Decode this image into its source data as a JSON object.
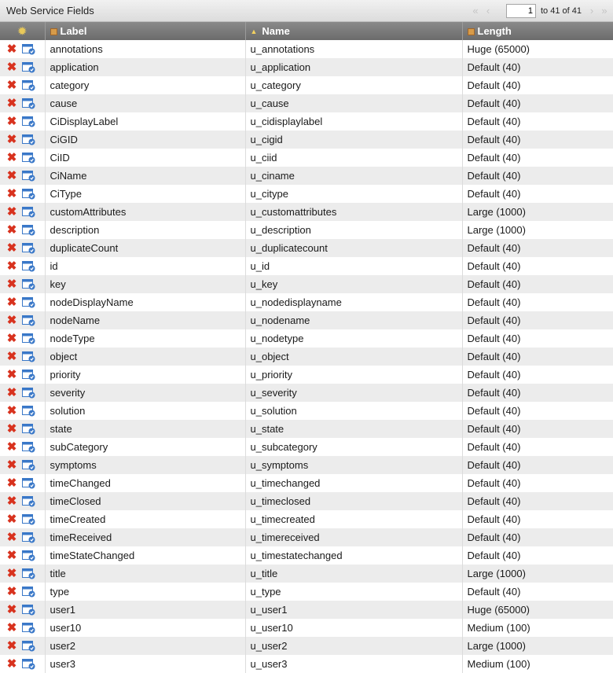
{
  "panel": {
    "title": "Web Service Fields"
  },
  "pager": {
    "current": "1",
    "total_text": "to 41 of 41"
  },
  "columns": {
    "label": "Label",
    "name": "Name",
    "length": "Length"
  },
  "rows": [
    {
      "label": "annotations",
      "name": "u_annotations",
      "length": "Huge (65000)"
    },
    {
      "label": "application",
      "name": "u_application",
      "length": "Default (40)"
    },
    {
      "label": "category",
      "name": "u_category",
      "length": "Default (40)"
    },
    {
      "label": "cause",
      "name": "u_cause",
      "length": "Default (40)"
    },
    {
      "label": "CiDisplayLabel",
      "name": "u_cidisplaylabel",
      "length": "Default (40)"
    },
    {
      "label": "CiGID",
      "name": "u_cigid",
      "length": "Default (40)"
    },
    {
      "label": "CiID",
      "name": "u_ciid",
      "length": "Default (40)"
    },
    {
      "label": "CiName",
      "name": "u_ciname",
      "length": "Default (40)"
    },
    {
      "label": "CiType",
      "name": "u_citype",
      "length": "Default (40)"
    },
    {
      "label": "customAttributes",
      "name": "u_customattributes",
      "length": "Large (1000)"
    },
    {
      "label": "description",
      "name": "u_description",
      "length": "Large (1000)"
    },
    {
      "label": "duplicateCount",
      "name": "u_duplicatecount",
      "length": "Default (40)"
    },
    {
      "label": "id",
      "name": "u_id",
      "length": "Default (40)"
    },
    {
      "label": "key",
      "name": "u_key",
      "length": "Default (40)"
    },
    {
      "label": "nodeDisplayName",
      "name": "u_nodedisplayname",
      "length": "Default (40)"
    },
    {
      "label": "nodeName",
      "name": "u_nodename",
      "length": "Default (40)"
    },
    {
      "label": "nodeType",
      "name": "u_nodetype",
      "length": "Default (40)"
    },
    {
      "label": "object",
      "name": "u_object",
      "length": "Default (40)"
    },
    {
      "label": "priority",
      "name": "u_priority",
      "length": "Default (40)"
    },
    {
      "label": "severity",
      "name": "u_severity",
      "length": "Default (40)"
    },
    {
      "label": "solution",
      "name": "u_solution",
      "length": "Default (40)"
    },
    {
      "label": "state",
      "name": "u_state",
      "length": "Default (40)"
    },
    {
      "label": "subCategory",
      "name": "u_subcategory",
      "length": "Default (40)"
    },
    {
      "label": "symptoms",
      "name": "u_symptoms",
      "length": "Default (40)"
    },
    {
      "label": "timeChanged",
      "name": "u_timechanged",
      "length": "Default (40)"
    },
    {
      "label": "timeClosed",
      "name": "u_timeclosed",
      "length": "Default (40)"
    },
    {
      "label": "timeCreated",
      "name": "u_timecreated",
      "length": "Default (40)"
    },
    {
      "label": "timeReceived",
      "name": "u_timereceived",
      "length": "Default (40)"
    },
    {
      "label": "timeStateChanged",
      "name": "u_timestatechanged",
      "length": "Default (40)"
    },
    {
      "label": "title",
      "name": "u_title",
      "length": "Large (1000)"
    },
    {
      "label": "type",
      "name": "u_type",
      "length": "Default (40)"
    },
    {
      "label": "user1",
      "name": "u_user1",
      "length": "Huge (65000)"
    },
    {
      "label": "user10",
      "name": "u_user10",
      "length": "Medium (100)"
    },
    {
      "label": "user2",
      "name": "u_user2",
      "length": "Large (1000)"
    },
    {
      "label": "user3",
      "name": "u_user3",
      "length": "Medium (100)"
    }
  ],
  "icons": {
    "delete": "delete-icon",
    "edit": "edit-record-icon",
    "columns": "gear-icon",
    "sort": "sort-ascending-icon",
    "type": "box-icon",
    "accent_delete": "#d8321e",
    "accent_edit": "#3a78c8"
  }
}
